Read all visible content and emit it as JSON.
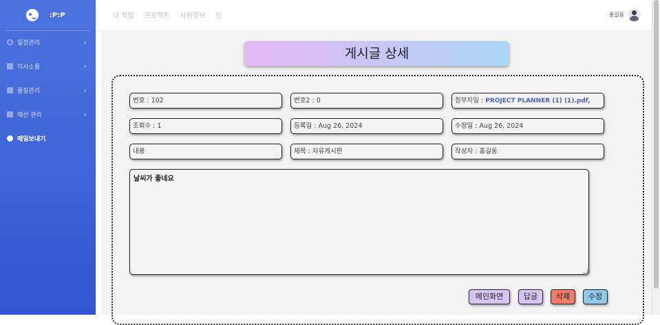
{
  "sidebar": {
    "brand": ":P:P",
    "items": [
      {
        "label": "일정관리",
        "icon": "gear-icon"
      },
      {
        "label": "의사소통",
        "icon": "folder-icon"
      },
      {
        "label": "품질관리",
        "icon": "folder-icon"
      },
      {
        "label": "예산 관리",
        "icon": "folder-icon"
      },
      {
        "label": "메일보내기",
        "icon": "mail-icon"
      }
    ]
  },
  "topbar": {
    "links": [
      "내 작업",
      "프로젝트",
      "사원정보",
      "팀"
    ],
    "user_name": "홍길동"
  },
  "page": {
    "title": "게시글 상세",
    "fields": {
      "number": "번호 : 102",
      "number2": "번호2 : 0",
      "attachment_label": "첨부파일 : ",
      "attachment_file": "PROJECT PLANNER (1) (1).pdf,",
      "views": "조회수 : 1",
      "created": "등록일 : Aug 26, 2024",
      "modified": "수정일 : Aug 26, 2024",
      "content_label": "내용",
      "title_label": "제목 : ",
      "title_value": "자유게시판",
      "author": "작성자 : 홍길동"
    },
    "body_text": "날씨가 좋네요",
    "buttons": {
      "main": "메인화면",
      "reply": "답글",
      "delete": "삭제",
      "edit": "수정"
    }
  },
  "colors": {
    "sidebar": "#4e73df",
    "delete_button": "#f07d6a",
    "edit_button": "#8fcbe6",
    "main_button": "#d7c6f5"
  }
}
